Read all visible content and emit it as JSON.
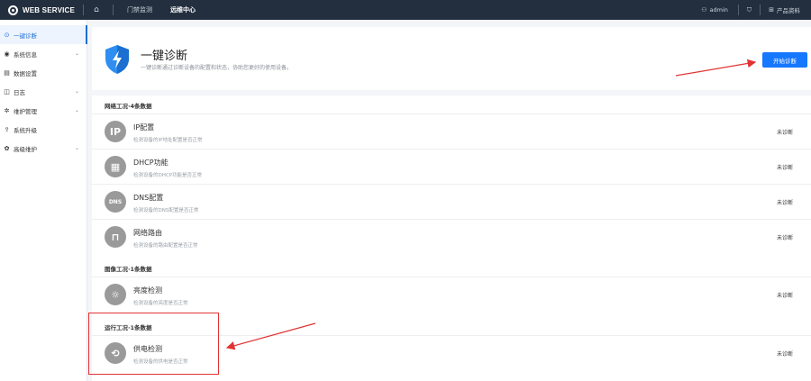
{
  "topbar": {
    "brand": "WEB SERVICE",
    "tabs": [
      {
        "label": "门禁监测",
        "active": false
      },
      {
        "label": "远维中心",
        "active": true
      }
    ],
    "user": "admin",
    "doc_label": "产品资料"
  },
  "sidebar": {
    "items": [
      {
        "label": "一键诊断",
        "icon": "diagnose-icon",
        "active": true,
        "expandable": false
      },
      {
        "label": "系统信息",
        "icon": "info-icon",
        "active": false,
        "expandable": true
      },
      {
        "label": "数据设置",
        "icon": "data-icon",
        "active": false,
        "expandable": false
      },
      {
        "label": "日志",
        "icon": "log-icon",
        "active": false,
        "expandable": true
      },
      {
        "label": "维护管理",
        "icon": "maintenance-icon",
        "active": false,
        "expandable": true
      },
      {
        "label": "系统升级",
        "icon": "upgrade-icon",
        "active": false,
        "expandable": false
      },
      {
        "label": "高级维护",
        "icon": "advanced-icon",
        "active": false,
        "expandable": true
      }
    ]
  },
  "header": {
    "title": "一键诊断",
    "desc": "一键诊断通过诊断设备的配置和状态，协助您更好的使用设备。",
    "start_button": "开始诊断"
  },
  "groups": [
    {
      "title": "网络工况·4条数据"
    },
    {
      "title": "图像工况·1条数据"
    },
    {
      "title": "运行工况·1条数据"
    }
  ],
  "rows": [
    {
      "title": "IP配置",
      "desc": "检测设备的IP地址配置是否正常",
      "status": "未诊断",
      "icon": "ip-icon",
      "glyph": "IP"
    },
    {
      "title": "DHCP功能",
      "desc": "检测设备的DHCP功能是否正常",
      "status": "未诊断",
      "icon": "dhcp-icon",
      "glyph": "▦"
    },
    {
      "title": "DNS配置",
      "desc": "检测设备的DNS配置是否正常",
      "status": "未诊断",
      "icon": "dns-icon",
      "glyph": "DNS"
    },
    {
      "title": "网络路由",
      "desc": "检测设备的路由配置是否正常",
      "status": "未诊断",
      "icon": "router-icon",
      "glyph": "⊓"
    },
    {
      "title": "亮度检测",
      "desc": "检测设备的亮度是否正常",
      "status": "未诊断",
      "icon": "brightness-icon",
      "glyph": "☼"
    },
    {
      "title": "供电检测",
      "desc": "检测设备的供电是否正常",
      "status": "未诊断",
      "icon": "power-icon",
      "glyph": "⟲"
    }
  ],
  "colors": {
    "topbar": "#232f3e",
    "accent": "#1677ff",
    "annotation": "#e23333",
    "row_icon": "#9a9a9a"
  }
}
